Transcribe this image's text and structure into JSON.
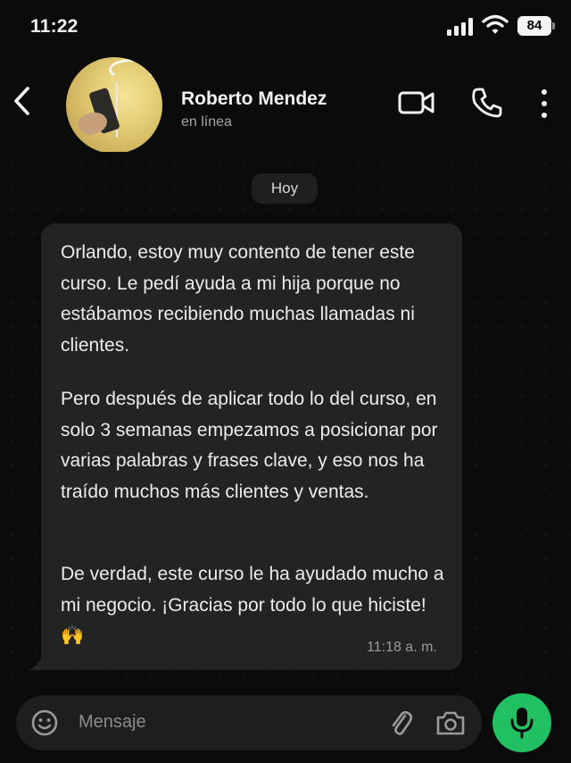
{
  "status_bar": {
    "time": "11:22",
    "battery": "84"
  },
  "header": {
    "contact_name": "Roberto Mendez",
    "contact_status": "en línea",
    "icons": {
      "back": "chevron-left-icon",
      "video": "video-camera-icon",
      "call": "phone-icon",
      "more": "more-vertical-icon"
    }
  },
  "chat": {
    "date_label": "Hoy",
    "message": {
      "paragraphs": [
        "Orlando, estoy muy contento de tener este curso. Le pedí ayuda a mi hija porque no estábamos recibiendo muchas llamadas ni clientes.",
        "Pero después de aplicar todo lo del curso, en solo 3 semanas empezamos a posicionar por varias palabras y frases clave, y eso nos ha traído muchos más clientes y ventas.",
        "De verdad, este curso le ha ayudado mucho a mi negocio. ¡Gracias por todo lo que hiciste! 🙌"
      ],
      "time": "11:18 a. m."
    }
  },
  "composer": {
    "placeholder": "Mensaje",
    "icons": {
      "emoji": "emoji-icon",
      "attach": "paperclip-icon",
      "camera": "camera-icon",
      "mic": "microphone-icon"
    }
  },
  "colors": {
    "background": "#0b0b0b",
    "bubble": "#232323",
    "composer": "#1e1e1e",
    "accent_green": "#21c063",
    "text_primary": "#ececec",
    "text_secondary": "#a6a6a6"
  }
}
